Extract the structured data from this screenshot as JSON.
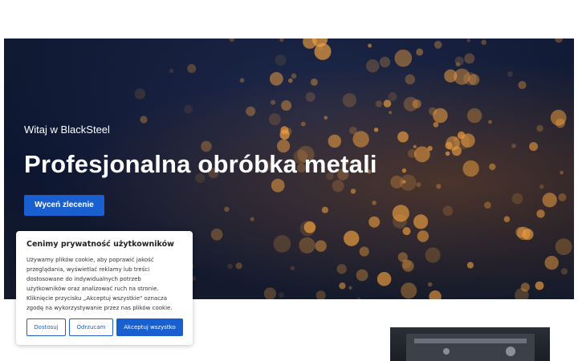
{
  "hero": {
    "greeting": "Witaj w BlackSteel",
    "title": "Profesjonalna obróbka metali",
    "cta_label": "Wyceń zlecenie"
  },
  "cookie_banner": {
    "title": "Cenimy prywatność użytkowników",
    "text": "Używamy plików cookie, aby poprawić jakość\nprzeglądania, wyświetlać reklamy lub treści\ndostosowane do indywidualnych potrzeb\nużytkowników oraz analizować ruch na stronie.\nKliknięcie przycisku „Akceptuj wszystkie\" oznacza\nzgodę na wykorzystywanie przez nas plików cookie.",
    "customize_label": "Dostosuj",
    "reject_label": "Odrzucam",
    "accept_label": "Akceptuj wszystko"
  },
  "colors": {
    "accent": "#1a5fcf",
    "hero_background": "#101a33",
    "spark": "#f0a040"
  }
}
